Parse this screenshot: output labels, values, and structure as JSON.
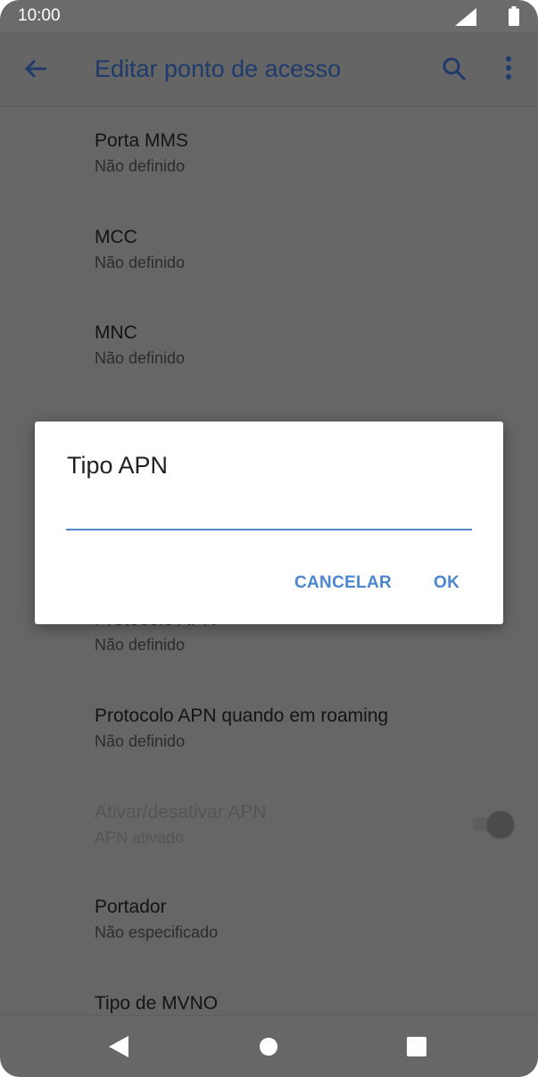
{
  "status_bar": {
    "time": "10:00",
    "icons": [
      "signal-icon",
      "battery-icon"
    ]
  },
  "app_bar": {
    "title": "Editar ponto de acesso",
    "icons": [
      "back-arrow-icon",
      "search-icon",
      "more-vert-icon"
    ]
  },
  "preferences": [
    {
      "title": "Porta MMS",
      "summary": "Não definido"
    },
    {
      "title": "MCC",
      "summary": "Não definido"
    },
    {
      "title": "MNC",
      "summary": "Não definido"
    },
    {
      "title": "Protocolo APN",
      "summary": "Não definido"
    },
    {
      "title": "Protocolo APN quando em roaming",
      "summary": "Não definido"
    },
    {
      "title": "Ativar/desativar APN",
      "summary": "APN ativado",
      "disabled": true,
      "toggle_on": true
    },
    {
      "title": "Portador",
      "summary": "Não especificado"
    },
    {
      "title": "Tipo de MVNO",
      "summary": ""
    }
  ],
  "dialog": {
    "title": "Tipo APN",
    "input_value": "",
    "cancel_label": "CANCELAR",
    "ok_label": "OK"
  },
  "nav_bar": {
    "icons": [
      "nav-back-icon",
      "nav-home-icon",
      "nav-recents-icon"
    ]
  },
  "colors": {
    "accent": "#4a86cf",
    "dim_overlay": "#666666",
    "dialog_bg": "#ffffff"
  }
}
